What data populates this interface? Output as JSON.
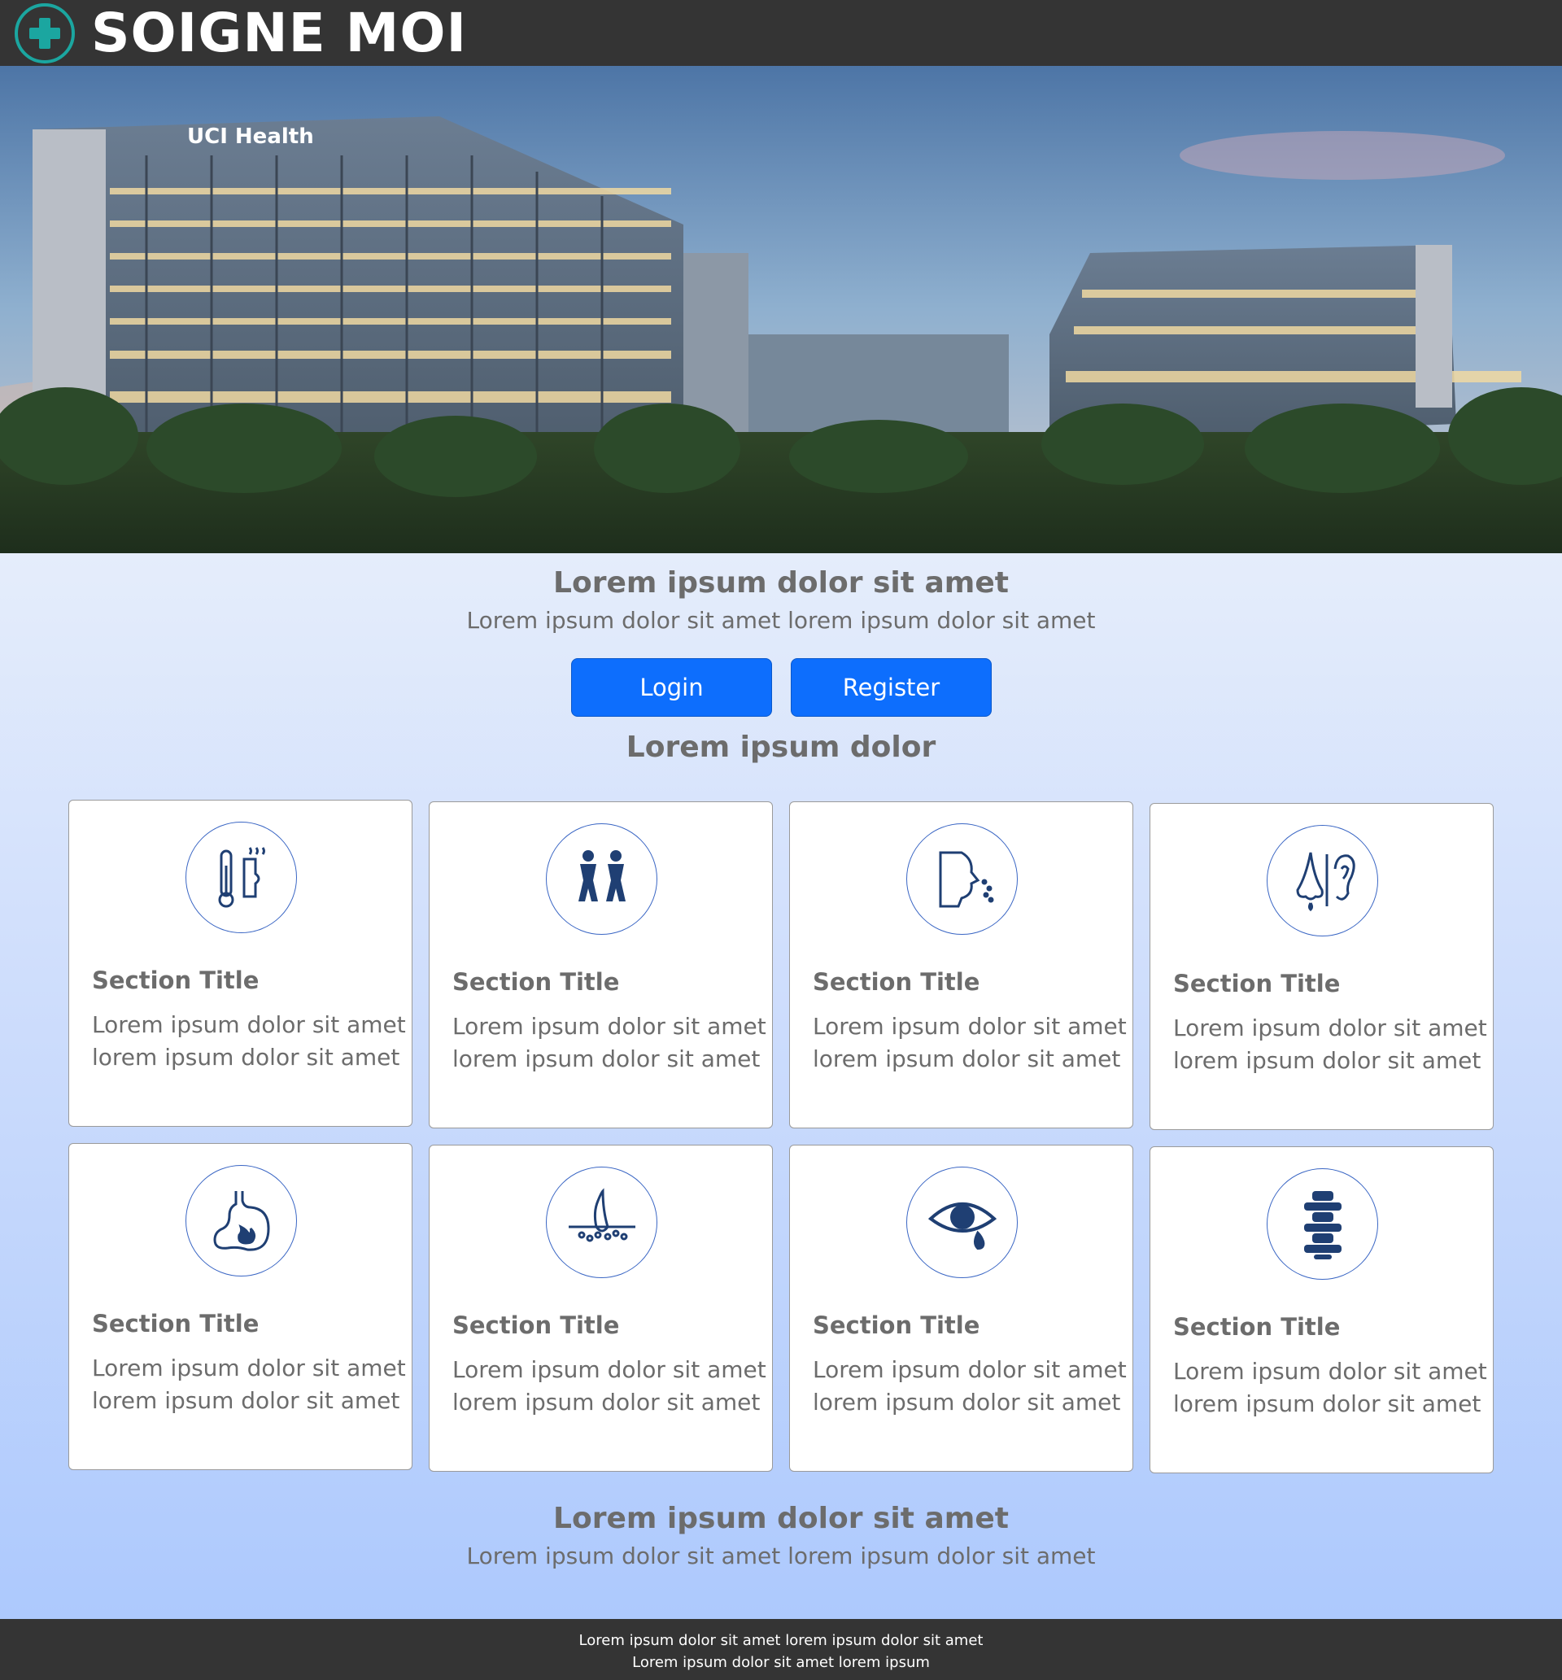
{
  "header": {
    "brand": "SOIGNE MOI",
    "logo_icon": "medical-cross-icon",
    "accent_color": "#1ba6a0"
  },
  "hero": {
    "image": "hospital-building-photo",
    "sign_text": "UCI Health"
  },
  "intro": {
    "title": "Lorem ipsum dolor sit amet",
    "subtitle": "Lorem ipsum dolor sit amet lorem ipsum dolor sit amet"
  },
  "actions": {
    "login_label": "Login",
    "register_label": "Register",
    "button_color": "#0d6efd"
  },
  "services": {
    "heading": "Lorem ipsum dolor",
    "cards": [
      {
        "icon": "fever-thermometer-icon",
        "title": "Section Title",
        "line1": "Lorem ipsum dolor sit amet",
        "line2": "lorem ipsum dolor sit amet"
      },
      {
        "icon": "urinary-icon",
        "title": "Section Title",
        "line1": "Lorem ipsum dolor sit amet",
        "line2": "lorem ipsum dolor sit amet"
      },
      {
        "icon": "cough-icon",
        "title": "Section Title",
        "line1": "Lorem ipsum dolor sit amet",
        "line2": "lorem ipsum dolor sit amet"
      },
      {
        "icon": "nose-ear-icon",
        "title": "Section Title",
        "line1": "Lorem ipsum dolor sit amet",
        "line2": "lorem ipsum dolor sit amet"
      },
      {
        "icon": "stomach-burn-icon",
        "title": "Section Title",
        "line1": "Lorem ipsum dolor sit amet",
        "line2": "lorem ipsum dolor sit amet"
      },
      {
        "icon": "skin-hair-icon",
        "title": "Section Title",
        "line1": "Lorem ipsum dolor sit amet",
        "line2": "lorem ipsum dolor sit amet"
      },
      {
        "icon": "eye-tear-icon",
        "title": "Section Title",
        "line1": "Lorem ipsum dolor sit amet",
        "line2": "lorem ipsum dolor sit amet"
      },
      {
        "icon": "spine-icon",
        "title": "Section Title",
        "line1": "Lorem ipsum dolor sit amet",
        "line2": "lorem ipsum dolor sit amet"
      }
    ]
  },
  "outro": {
    "title": "Lorem ipsum dolor sit amet",
    "subtitle": "Lorem ipsum dolor sit amet lorem ipsum dolor sit amet"
  },
  "footer": {
    "line1": "Lorem ipsum dolor sit amet lorem ipsum dolor sit amet",
    "line2": "Lorem ipsum dolor sit amet lorem ipsum"
  }
}
